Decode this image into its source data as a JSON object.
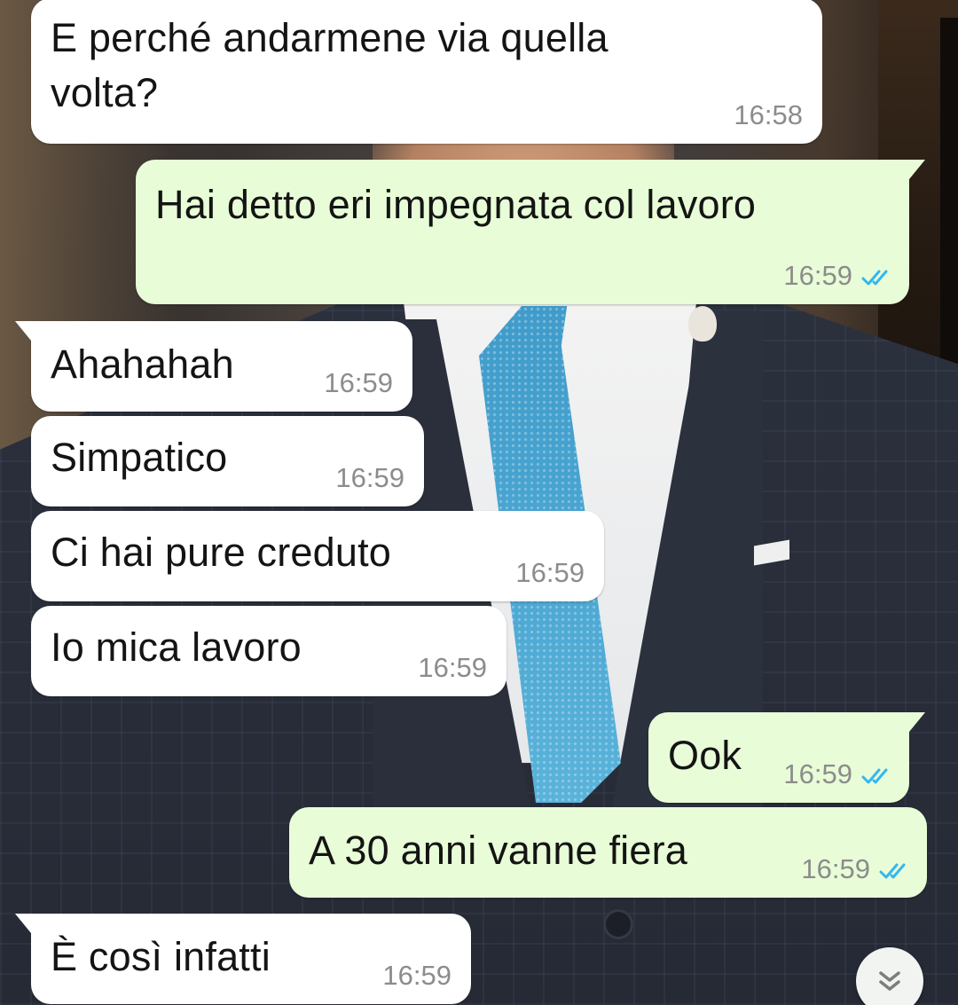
{
  "conversation": {
    "messages": [
      {
        "direction": "incoming",
        "text": "E perché andarmene via quella\nvolta?",
        "time": "16:58"
      },
      {
        "direction": "outgoing",
        "text": "Hai detto eri impegnata col lavoro",
        "time": "16:59",
        "status": "read"
      },
      {
        "direction": "incoming",
        "text": "Ahahahah",
        "time": "16:59"
      },
      {
        "direction": "incoming",
        "text": "Simpatico",
        "time": "16:59"
      },
      {
        "direction": "incoming",
        "text": "Ci hai pure creduto",
        "time": "16:59"
      },
      {
        "direction": "incoming",
        "text": "Io mica lavoro",
        "time": "16:59"
      },
      {
        "direction": "outgoing",
        "text": "Ook",
        "time": "16:59",
        "status": "read"
      },
      {
        "direction": "outgoing",
        "text": "A 30 anni vanne fiera",
        "time": "16:59",
        "status": "read"
      },
      {
        "direction": "incoming",
        "text": "È così infatti",
        "time": "16:59"
      }
    ]
  },
  "colors": {
    "incoming_bubble": "#ffffff",
    "outgoing_bubble": "#e8fdd7",
    "read_ticks": "#34b7f1",
    "timestamp": "#8c8c8c"
  },
  "icons": {
    "read_status": "double-check-icon",
    "scroll_down": "chevron-double-down-icon"
  }
}
